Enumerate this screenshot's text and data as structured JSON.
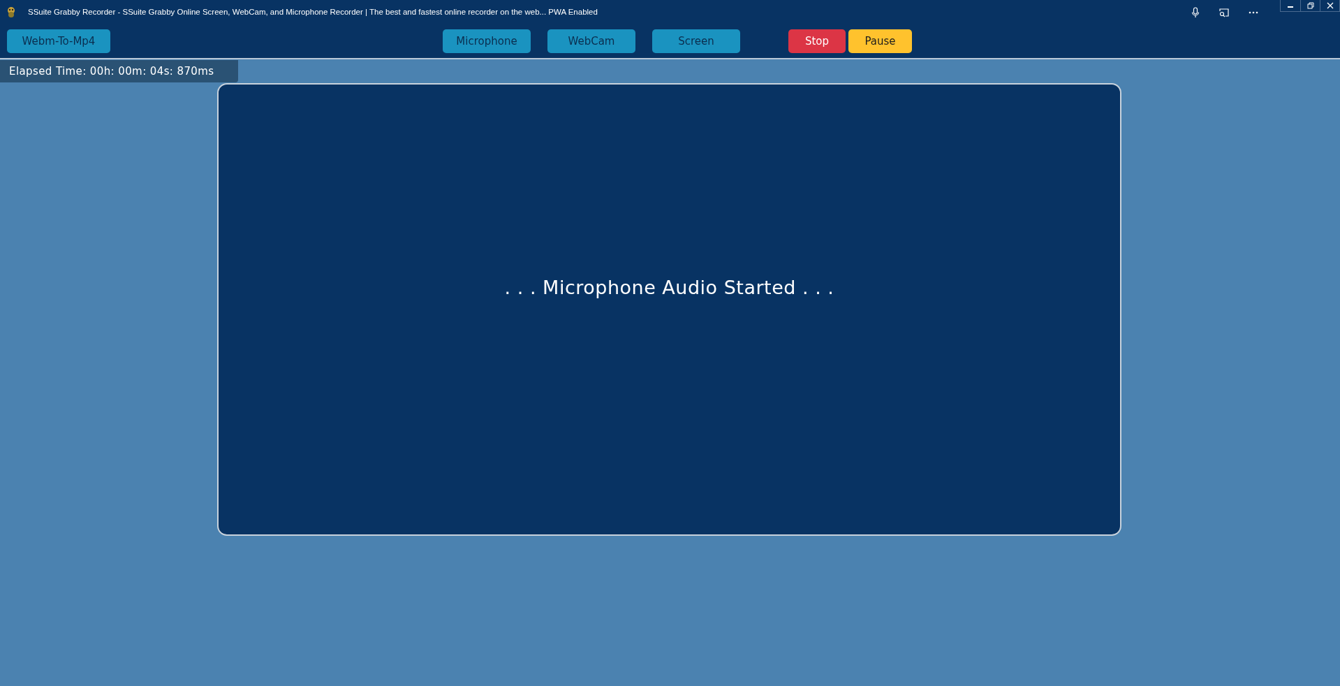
{
  "window": {
    "title": "SSuite Grabby Recorder - SSuite Grabby Online Screen, WebCam, and Microphone Recorder | The best and fastest online recorder on the web... PWA Enabled"
  },
  "toolbar": {
    "left": [
      {
        "label": "Webm-To-Mp4",
        "kind": "info"
      }
    ],
    "center": [
      {
        "label": "Microphone",
        "kind": "info"
      },
      {
        "label": "WebCam",
        "kind": "info"
      },
      {
        "label": "Screen",
        "kind": "info"
      }
    ],
    "right": [
      {
        "label": "Stop",
        "kind": "danger"
      },
      {
        "label": "Pause",
        "kind": "warning"
      }
    ]
  },
  "elapsed": "Elapsed Time: 00h: 00m: 04s: 870ms",
  "stage": {
    "message": ". . . Microphone Audio Started . . ."
  }
}
